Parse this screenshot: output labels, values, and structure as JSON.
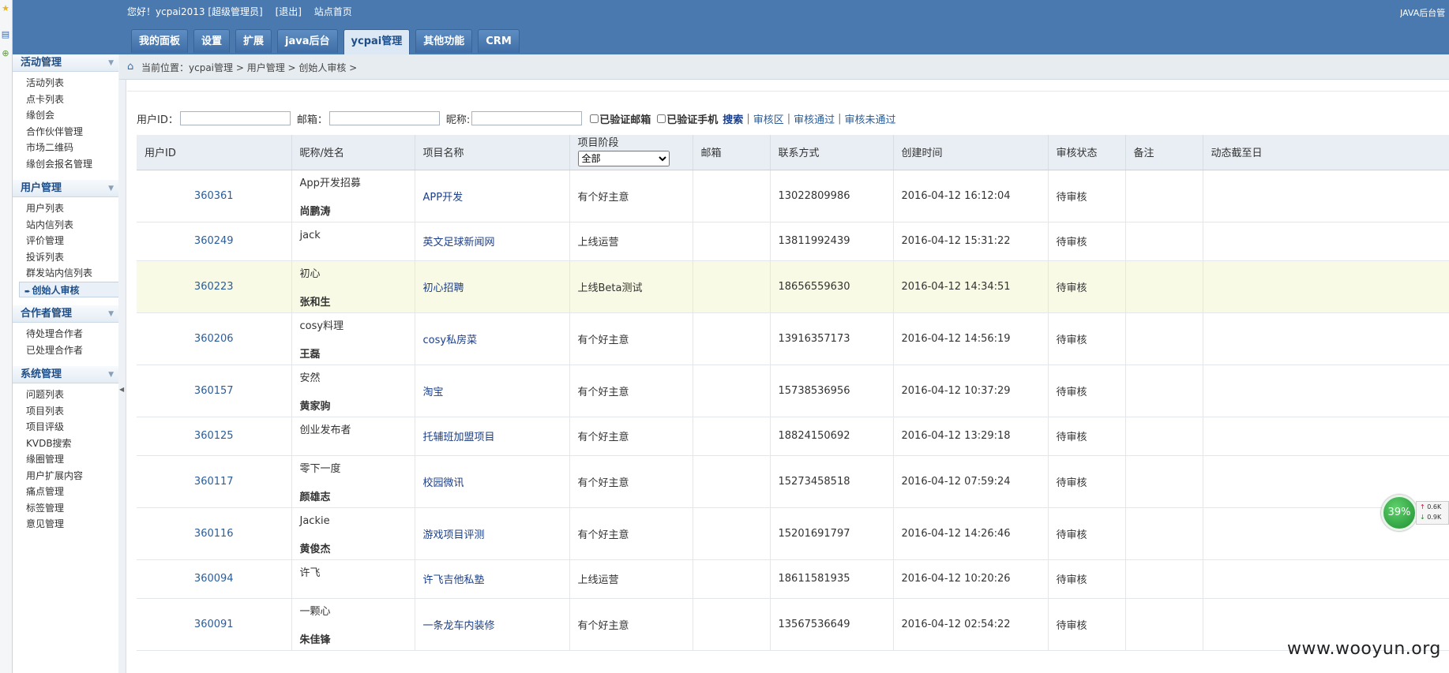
{
  "topbar": {
    "greeting": "您好！ycpai2013 [超级管理员]",
    "logout": "[退出]",
    "site_home": "站点首页",
    "right_text": "JAVA后台管"
  },
  "tabs": [
    "我的面板",
    "设置",
    "扩展",
    "java后台",
    "ycpai管理",
    "其他功能",
    "CRM"
  ],
  "active_tab": "ycpai管理",
  "breadcrumb": "当前位置：ycpai管理 > 用户管理 > 创始人审核 >",
  "sidebar": {
    "groups": [
      {
        "title": "活动管理",
        "items": [
          "活动列表",
          "点卡列表",
          "缘创会",
          "合作伙伴管理",
          "市场二维码",
          "缘创会报名管理"
        ]
      },
      {
        "title": "用户管理",
        "items": [
          "用户列表",
          "站内信列表",
          "评价管理",
          "投诉列表",
          "群发站内信列表",
          "创始人审核"
        ]
      },
      {
        "title": "合作者管理",
        "items": [
          "待处理合作者",
          "已处理合作者"
        ]
      },
      {
        "title": "系统管理",
        "items": [
          "问题列表",
          "项目列表",
          "项目评级",
          "KVDB搜索",
          "缘圈管理",
          "用户扩展内容",
          "痛点管理",
          "标签管理",
          "意见管理"
        ]
      }
    ],
    "active_item": "创始人审核"
  },
  "filter": {
    "user_id_label": "用户ID：",
    "email_label": "邮箱：",
    "nickname_label": "昵称:",
    "verified_email": "已验证邮箱",
    "verified_phone": "已验证手机",
    "search": "搜索",
    "sep": "|",
    "review_zone": "审核区",
    "review_passed": "审核通过",
    "review_failed": "审核未通过"
  },
  "table": {
    "headers": [
      "用户ID",
      "昵称/姓名",
      "项目名称",
      "项目阶段",
      "邮箱",
      "联系方式",
      "创建时间",
      "审核状态",
      "备注",
      "动态截至日"
    ],
    "stage_select_value": "全部",
    "rows": [
      {
        "uid": "360361",
        "nick": "App开发招募",
        "name": "尚鹏涛",
        "project": "APP开发",
        "stage": "有个好主意",
        "email": "",
        "phone": "13022809986",
        "created": "2016-04-12 16:12:04",
        "status": "待审核",
        "note": "",
        "dyn": ""
      },
      {
        "uid": "360249",
        "nick": "jack",
        "name": "",
        "project": "英文足球新闻网",
        "stage": "上线运营",
        "email": "",
        "phone": "13811992439",
        "created": "2016-04-12 15:31:22",
        "status": "待审核",
        "note": "",
        "dyn": ""
      },
      {
        "uid": "360223",
        "nick": "初心",
        "name": "张和生",
        "project": "初心招聘",
        "stage": "上线Beta测试",
        "email": "",
        "phone": "18656559630",
        "created": "2016-04-12 14:34:51",
        "status": "待审核",
        "note": "",
        "dyn": ""
      },
      {
        "uid": "360206",
        "nick": "cosy料理",
        "name": "王磊",
        "project": "cosy私房菜",
        "stage": "有个好主意",
        "email": "",
        "phone": "13916357173",
        "created": "2016-04-12 14:56:19",
        "status": "待审核",
        "note": "",
        "dyn": ""
      },
      {
        "uid": "360157",
        "nick": "安然",
        "name": "黄家驹",
        "project": "淘宝",
        "stage": "有个好主意",
        "email": "",
        "phone": "15738536956",
        "created": "2016-04-12 10:37:29",
        "status": "待审核",
        "note": "",
        "dyn": ""
      },
      {
        "uid": "360125",
        "nick": "创业发布者",
        "name": "",
        "project": "托辅班加盟项目",
        "stage": "有个好主意",
        "email": "",
        "phone": "18824150692",
        "created": "2016-04-12 13:29:18",
        "status": "待审核",
        "note": "",
        "dyn": ""
      },
      {
        "uid": "360117",
        "nick": "零下一度",
        "name": "颜雄志",
        "project": "校园微讯",
        "stage": "有个好主意",
        "email": "",
        "phone": "15273458518",
        "created": "2016-04-12 07:59:24",
        "status": "待审核",
        "note": "",
        "dyn": ""
      },
      {
        "uid": "360116",
        "nick": "Jackie",
        "name": "黄俊杰",
        "project": "游戏项目评测",
        "stage": "有个好主意",
        "email": "",
        "phone": "15201691797",
        "created": "2016-04-12 14:26:46",
        "status": "待审核",
        "note": "",
        "dyn": ""
      },
      {
        "uid": "360094",
        "nick": "许飞",
        "name": "",
        "project": "许飞吉他私塾",
        "stage": "上线运营",
        "email": "",
        "phone": "18611581935",
        "created": "2016-04-12 10:20:26",
        "status": "待审核",
        "note": "",
        "dyn": ""
      },
      {
        "uid": "360091",
        "nick": "一颗心",
        "name": "朱佳锋",
        "project": "一条龙车内装修",
        "stage": "有个好主意",
        "email": "",
        "phone": "13567536649",
        "created": "2016-04-12 02:54:22",
        "status": "待审核",
        "note": "",
        "dyn": ""
      }
    ],
    "highlighted_row": 2
  },
  "widget": {
    "percent": "39%",
    "up": "0.6K",
    "down": "0.9K"
  },
  "watermark": "www.wooyun.org",
  "colors": {
    "header": "#4a79b0",
    "link": "#2a5d9a",
    "highlight_row": "#f8fae5"
  }
}
